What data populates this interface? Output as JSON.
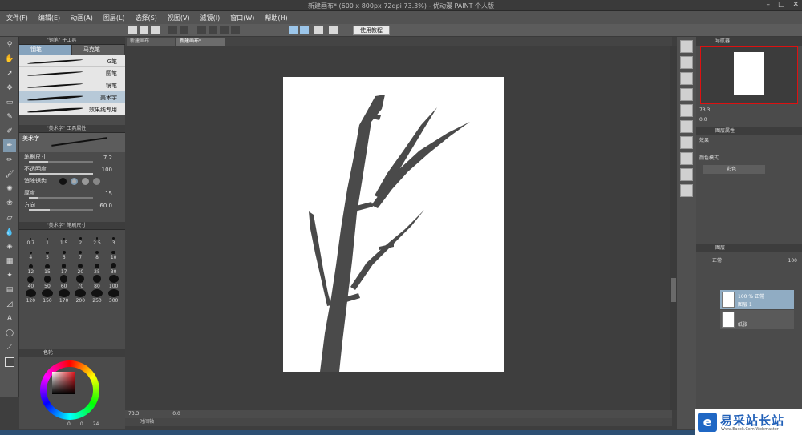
{
  "window": {
    "title": "新建画布* (600 x 800px 72dpi 73.3%)  - 优动漫 PAINT 个人版",
    "controls": [
      "–",
      "□",
      "✕"
    ]
  },
  "menu": [
    "文件(F)",
    "编辑(E)",
    "动画(A)",
    "图层(L)",
    "选择(S)",
    "视图(V)",
    "滤镜(I)",
    "窗口(W)",
    "帮助(H)"
  ],
  "toolbar": {
    "tutorial_label": "使用教程"
  },
  "doc_tabs": [
    "新建画布",
    "新建画布*"
  ],
  "subtool_panel": {
    "title": "\"钢笔\" 子工具",
    "tabs": [
      "钢笔",
      "马克笔"
    ],
    "brushes": [
      "G笔",
      "圆笔",
      "镜笔",
      "美术字",
      "效果线专用"
    ],
    "selected": "美术字"
  },
  "tool_property": {
    "title": "\"美术字\" 工具属性",
    "preview_label": "美术字",
    "brush_size_label": "笔刷尺寸",
    "brush_size_value": "7.2",
    "opacity_label": "不透明度",
    "opacity_value": "100",
    "antialias_label": "消除锯齿",
    "thickness_label": "厚度",
    "thickness_value": "15",
    "direction_label": "方向",
    "direction_value": "60.0"
  },
  "brush_size_panel": {
    "title": "\"美术字\" 笔刷尺寸",
    "sizes": [
      "0.7",
      "1",
      "1.5",
      "2",
      "2.5",
      "3",
      "4",
      "5",
      "6",
      "7",
      "8",
      "10",
      "12",
      "15",
      "17",
      "20",
      "25",
      "30",
      "40",
      "50",
      "60",
      "70",
      "80",
      "100",
      "120",
      "150",
      "170",
      "200",
      "250",
      "300"
    ]
  },
  "color_panel": {
    "tab_label": "色轮",
    "hsv_readout": [
      "0",
      "0",
      "24"
    ]
  },
  "statusbar": {
    "zoom": "73.3",
    "angle": "0.0",
    "timeline_label": "时间轴"
  },
  "navigator": {
    "tab_label": "导航器",
    "zoom": "73.3",
    "angle": "0.0"
  },
  "layer_property": {
    "tab_label": "图层属性",
    "effect_label": "效果",
    "color_mode_label": "颜色模式",
    "color_mode_value": "彩色"
  },
  "layer_panel": {
    "tab_label": "图层",
    "blend_mode": "正常",
    "opacity": "100",
    "layers": [
      {
        "line1": "100 % 正常",
        "line2": "图层 1"
      },
      {
        "line1": "",
        "line2": "纸张"
      }
    ]
  },
  "watermark": {
    "main": "易采站长站",
    "url": "Www.Easck.Com  Webmaster"
  },
  "colors": {
    "selected_blue": "#86a3bd",
    "canvas_bg": "#3e3e3e",
    "ink": "#4a4a4a"
  }
}
